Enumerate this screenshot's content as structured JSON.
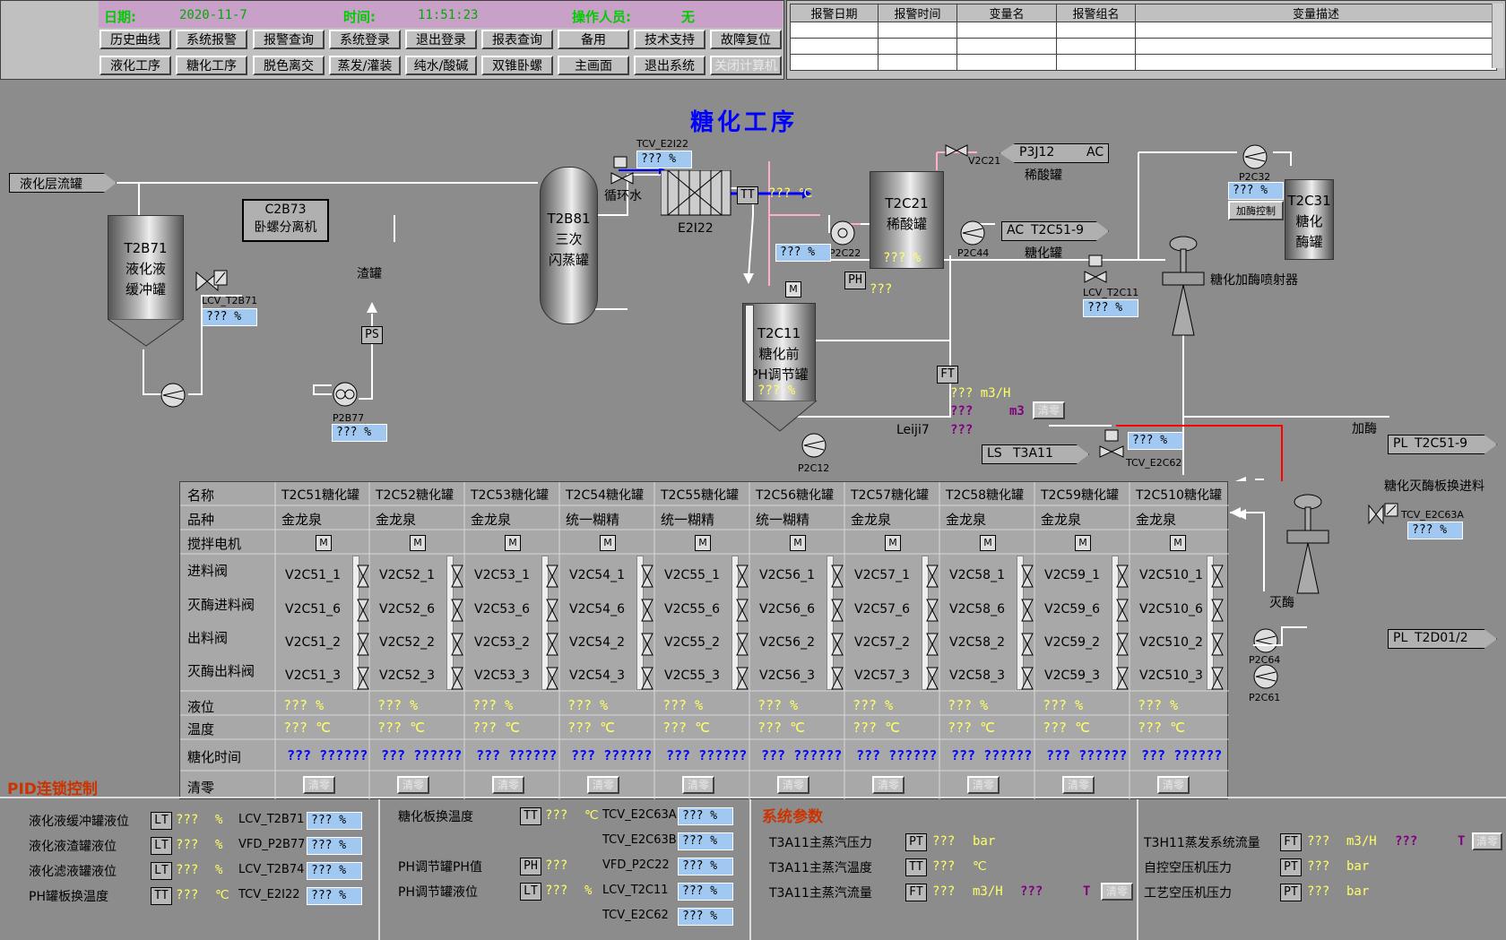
{
  "header": {
    "date_label": "日期:",
    "date_value": "2020-11-7",
    "time_label": "时间:",
    "time_value": "11:51:23",
    "operator_label": "操作人员:",
    "operator_value": "无"
  },
  "nav_row1": [
    "历史曲线",
    "系统报警",
    "报警查询",
    "系统登录",
    "退出登录",
    "报表查询",
    "备用",
    "技术支持",
    "故障复位"
  ],
  "nav_row2": [
    "液化工序",
    "糖化工序",
    "脱色离交",
    "蒸发/灌装",
    "纯水/酸碱",
    "双锥卧螺",
    "主画面",
    "退出系统",
    "关闭计算机"
  ],
  "alarm_table": {
    "headers": [
      "报警日期",
      "报警时间",
      "变量名",
      "报警组名",
      "变量描述"
    ]
  },
  "page_title": "糖化工序",
  "process": {
    "inlet_label": "液化层流罐",
    "t2b71": [
      "T2B71",
      "液化液",
      "缓冲罐"
    ],
    "c2b73": [
      "C2B73",
      "卧螺分离机"
    ],
    "slag_tank": "渣罐",
    "ps": "PS",
    "p2b77": "P2B77",
    "p2b77_val": "???  %",
    "lcv_t2b71": "LCV_T2B71",
    "lcv_t2b71_val": "???  %",
    "t2b81": [
      "T2B81",
      "三次",
      "闪蒸罐"
    ],
    "tcv_e2i22": "TCV_E2I22",
    "tcv_e2i22_val": "???  %",
    "circ_water": "循环水",
    "e2i22": "E2I22",
    "tt": "TT",
    "tt_val": "??? ℃",
    "t2c21": [
      "T2C21",
      "稀酸罐"
    ],
    "t2c21_val": "???  %",
    "p2c22": "P2C22",
    "p2c22_val": "???  %",
    "v2c21": "V2C21",
    "p3j12": "P3J12",
    "ac": "AC",
    "dilute_acid": "稀酸罐",
    "p2c44": "P2C44",
    "t2c51_9": "T2C51-9",
    "saccharify_tank": "糖化罐",
    "t2c11": [
      "T2C11",
      "糖化前",
      "PH调节罐"
    ],
    "t2c11_val": "???  %",
    "m": "M",
    "ph": "PH",
    "ph_val": "???",
    "ft": "FT",
    "ft_val1": "??? m3/H",
    "ft_val2": "???",
    "ft_unit2": "m3",
    "leiji": "Leiji7",
    "leiji_val": "???",
    "clear": "清零",
    "lcv_t2c11": "LCV_T2C11",
    "lcv_t2c11_val": "???  %",
    "p2c32": "P2C32",
    "p2c32_val": "???  %",
    "enzyme_ctrl": "加酶控制",
    "t2c31": [
      "T2C31",
      "糖化",
      "酶罐"
    ],
    "injector": "糖化加酶喷射器",
    "p2c12": "P2C12",
    "ls": "LS",
    "t3a11": "T3A11",
    "tcv_e2c62": "TCV_E2C62",
    "tcv_e2c62_val": "???  %",
    "add_enzyme": "加酶",
    "pl": "PL",
    "pl_t2c51_9": "T2C51-9",
    "enzyme_kill_in": "糖化灭酶板换进料",
    "tcv_e2c63a": "TCV_E2C63A",
    "tcv_e2c63a_val": "???  %",
    "kill_enzyme": "灭酶",
    "p2c64": "P2C64",
    "p2c61": "P2C61",
    "pl_t2d01": "T2D01/2"
  },
  "grid": {
    "row_labels": [
      "名称",
      "品种",
      "搅拌电机",
      "进料阀",
      "灭酶进料阀",
      "出料阀",
      "灭酶出料阀",
      "液位",
      "温度",
      "糖化时间",
      "清零"
    ],
    "columns": [
      {
        "name": "T2C51糖化罐",
        "variety": "金龙泉",
        "valves": [
          "V2C51_1",
          "V2C51_6",
          "V2C51_2",
          "V2C51_3"
        ]
      },
      {
        "name": "T2C52糖化罐",
        "variety": "金龙泉",
        "valves": [
          "V2C52_1",
          "V2C52_6",
          "V2C52_2",
          "V2C52_3"
        ]
      },
      {
        "name": "T2C53糖化罐",
        "variety": "金龙泉",
        "valves": [
          "V2C53_1",
          "V2C53_6",
          "V2C53_2",
          "V2C53_3"
        ]
      },
      {
        "name": "T2C54糖化罐",
        "variety": "统一糊精",
        "valves": [
          "V2C54_1",
          "V2C54_6",
          "V2C54_2",
          "V2C54_3"
        ]
      },
      {
        "name": "T2C55糖化罐",
        "variety": "统一糊精",
        "valves": [
          "V2C55_1",
          "V2C55_6",
          "V2C55_2",
          "V2C55_3"
        ]
      },
      {
        "name": "T2C56糖化罐",
        "variety": "统一糊精",
        "valves": [
          "V2C56_1",
          "V2C56_6",
          "V2C56_2",
          "V2C56_3"
        ]
      },
      {
        "name": "T2C57糖化罐",
        "variety": "金龙泉",
        "valves": [
          "V2C57_1",
          "V2C57_6",
          "V2C57_2",
          "V2C57_3"
        ]
      },
      {
        "name": "T2C58糖化罐",
        "variety": "金龙泉",
        "valves": [
          "V2C58_1",
          "V2C58_6",
          "V2C58_2",
          "V2C58_3"
        ]
      },
      {
        "name": "T2C59糖化罐",
        "variety": "金龙泉",
        "valves": [
          "V2C59_1",
          "V2C59_6",
          "V2C59_2",
          "V2C59_3"
        ]
      },
      {
        "name": "T2C510糖化罐",
        "variety": "金龙泉",
        "valves": [
          "V2C510_1",
          "V2C510_6",
          "V2C510_2",
          "V2C510_3"
        ]
      }
    ],
    "level_val": "???  %",
    "temp_val": "???  ℃",
    "time_val": "??? ??????",
    "clear_label": "清零"
  },
  "pid": {
    "title": "PID连锁控制",
    "col1": [
      {
        "label": "液化液缓冲罐液位",
        "inst": "LT",
        "val": "???",
        "unit": "%",
        "ctrl": "LCV_T2B71",
        "cval": "???  %"
      },
      {
        "label": "液化液渣罐液位",
        "inst": "LT",
        "val": "???",
        "unit": "%",
        "ctrl": "VFD_P2B77",
        "cval": "???  %"
      },
      {
        "label": "液化滤液罐液位",
        "inst": "LT",
        "val": "???",
        "unit": "%",
        "ctrl": "LCV_T2B74",
        "cval": "???  %"
      },
      {
        "label": "PH罐板换温度",
        "inst": "TT",
        "val": "???",
        "unit": "℃",
        "ctrl": "TCV_E2I22",
        "cval": "???  %"
      }
    ],
    "col2_rows": [
      {
        "label": "糖化板换温度",
        "inst": "TT",
        "val": "???",
        "unit": "℃",
        "ctrl": "TCV_E2C63A",
        "cval": "???  %"
      },
      {
        "label": "",
        "inst": "",
        "val": "",
        "unit": "",
        "ctrl": "TCV_E2C63B",
        "cval": "???  %"
      },
      {
        "label": "PH调节罐PH值",
        "inst": "PH",
        "val": "???",
        "unit": "",
        "ctrl": "VFD_P2C22",
        "cval": "???  %"
      },
      {
        "label": "PH调节罐液位",
        "inst": "LT",
        "val": "???",
        "unit": "%",
        "ctrl": "LCV_T2C11",
        "cval": "???  %"
      },
      {
        "label": "",
        "inst": "",
        "val": "",
        "unit": "",
        "ctrl": "TCV_E2C62",
        "cval": "???  %"
      }
    ],
    "sys_title": "系统参数",
    "sys_rows": [
      {
        "label": "T3A11主蒸汽压力",
        "inst": "PT",
        "val": "???",
        "unit": "bar"
      },
      {
        "label": "T3A11主蒸汽温度",
        "inst": "TT",
        "val": "???",
        "unit": "℃"
      },
      {
        "label": "T3A11主蒸汽流量",
        "inst": "FT",
        "val": "???",
        "unit": "m3/H",
        "total": "???",
        "t": "T",
        "clear": "清零"
      }
    ],
    "right_rows": [
      {
        "label": "T3H11蒸发系统流量",
        "inst": "FT",
        "val": "???",
        "unit": "m3/H",
        "total": "???",
        "t": "T",
        "clear": "清零"
      },
      {
        "label": "自控空压机压力",
        "inst": "PT",
        "val": "???",
        "unit": "bar"
      },
      {
        "label": "工艺空压机压力",
        "inst": "PT",
        "val": "???",
        "unit": "bar"
      }
    ]
  }
}
